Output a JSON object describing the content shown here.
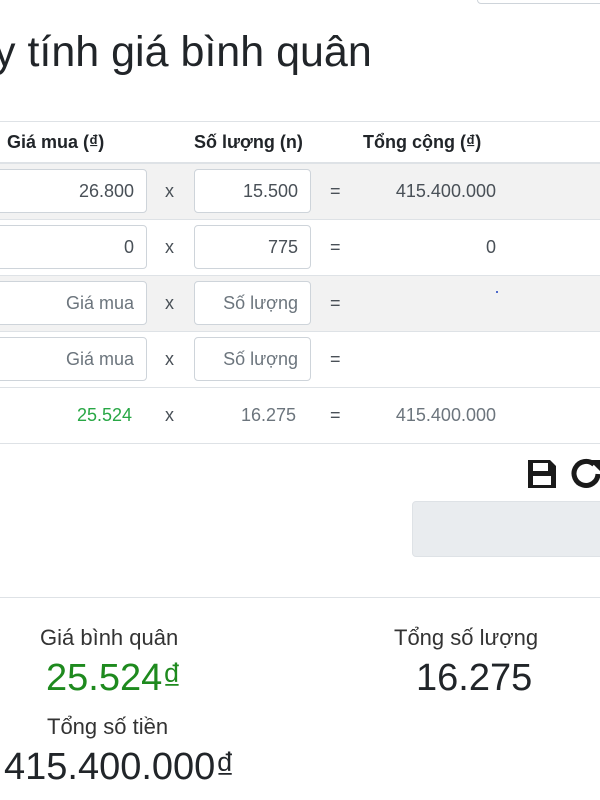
{
  "header": {
    "title": "y tính giá bình quân"
  },
  "table": {
    "columns": {
      "price": "Giá mua (₫)",
      "quantity": "Số lượng (n)",
      "total": "Tổng cộng (₫)"
    },
    "operators": {
      "times": "x",
      "equals": "="
    },
    "rows": [
      {
        "price": "26.800",
        "quantity": "15.500",
        "total": "415.400.000"
      },
      {
        "price": "0",
        "quantity": "775",
        "total": "0"
      },
      {
        "price": "",
        "quantity": "",
        "total": ""
      },
      {
        "price": "",
        "quantity": "",
        "total": ""
      }
    ],
    "placeholders": {
      "price": "Giá mua",
      "quantity": "Số lượng"
    },
    "summary": {
      "price": "25.524",
      "quantity": "16.275",
      "total": "415.400.000"
    }
  },
  "toolbar": {
    "save_icon": "floppy-disk-icon",
    "refresh_icon": "refresh-icon"
  },
  "results": {
    "avg_price_label": "Giá bình quân",
    "avg_price_value": "25.524₫",
    "total_qty_label": "Tổng số lượng",
    "total_qty_value": "16.275",
    "total_money_label": "Tổng số tiền",
    "total_money_value": "415.400.000₫"
  },
  "colors": {
    "accent_green": "#28a745",
    "striped_row": "#f2f2f2",
    "border": "#dee2e6"
  }
}
